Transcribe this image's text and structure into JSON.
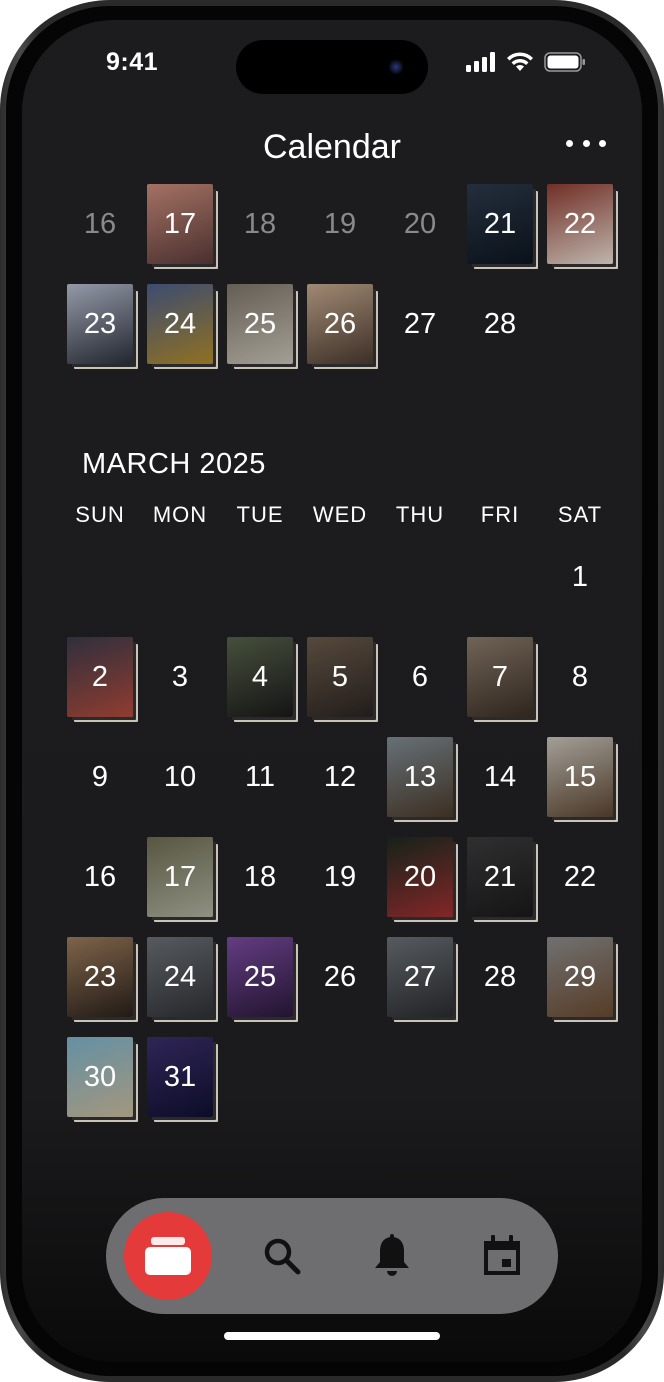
{
  "status_bar": {
    "time": "9:41"
  },
  "header": {
    "title": "Calendar",
    "more_icon": "ellipsis-icon"
  },
  "feb_partial": {
    "rows": [
      [
        {
          "day": "16",
          "dim": true
        },
        {
          "day": "17",
          "dim": true,
          "photo": [
            "#c98b7a",
            "#5a3b3a"
          ]
        },
        {
          "day": "18",
          "dim": true
        },
        {
          "day": "19",
          "dim": true
        },
        {
          "day": "20",
          "dim": true
        },
        {
          "day": "21",
          "dim": true,
          "photo": [
            "#2b3a4a",
            "#0d1520"
          ]
        },
        {
          "day": "22",
          "dim": true,
          "photo": [
            "#8a3a2f",
            "#e8ddd2"
          ]
        }
      ],
      [
        {
          "day": "23",
          "photo": [
            "#b5bccd",
            "#2a2f3a"
          ]
        },
        {
          "day": "24",
          "photo": [
            "#4a5d8a",
            "#b08a2a"
          ]
        },
        {
          "day": "25",
          "photo": [
            "#7b7368",
            "#c8c2b6"
          ]
        },
        {
          "day": "26",
          "photo": [
            "#c4a88d",
            "#4a3a30"
          ]
        },
        {
          "day": "27"
        },
        {
          "day": "28"
        }
      ]
    ]
  },
  "march": {
    "title": "MARCH 2025",
    "weekdays": [
      "SUN",
      "MON",
      "TUE",
      "WED",
      "THU",
      "FRI",
      "SAT"
    ],
    "rows": [
      [
        {},
        {},
        {},
        {},
        {},
        {},
        {
          "day": "1"
        }
      ],
      [
        {
          "day": "2",
          "photo": [
            "#3a3a4a",
            "#b04a3a"
          ]
        },
        {
          "day": "3"
        },
        {
          "day": "4",
          "photo": [
            "#56614a",
            "#1a1a1a"
          ]
        },
        {
          "day": "5",
          "photo": [
            "#6a5a4a",
            "#2a2421"
          ]
        },
        {
          "day": "6"
        },
        {
          "day": "7",
          "photo": [
            "#8a7a6a",
            "#3a2e25"
          ]
        },
        {
          "day": "8"
        }
      ],
      [
        {
          "day": "9"
        },
        {
          "day": "10"
        },
        {
          "day": "11"
        },
        {
          "day": "12"
        },
        {
          "day": "13",
          "photo": [
            "#7d8a92",
            "#4a3a2a"
          ]
        },
        {
          "day": "14"
        },
        {
          "day": "15",
          "photo": [
            "#c7c2b8",
            "#5a4430"
          ]
        }
      ],
      [
        {
          "day": "16"
        },
        {
          "day": "17",
          "photo": [
            "#6a6a50",
            "#b0b0a0"
          ]
        },
        {
          "day": "18"
        },
        {
          "day": "19"
        },
        {
          "day": "20",
          "photo": [
            "#1a2a20",
            "#a03030"
          ]
        },
        {
          "day": "21",
          "photo": [
            "#3a3a3a",
            "#1a1a1a"
          ]
        },
        {
          "day": "22"
        }
      ],
      [
        {
          "day": "23",
          "photo": [
            "#9a7a5a",
            "#2a211b"
          ]
        },
        {
          "day": "24",
          "photo": [
            "#6a6e74",
            "#2f3236"
          ]
        },
        {
          "day": "25",
          "photo": [
            "#7a4aa0",
            "#2a1a3a"
          ]
        },
        {
          "day": "26"
        },
        {
          "day": "27",
          "photo": [
            "#6a6f74",
            "#2a2c30"
          ]
        },
        {
          "day": "28"
        },
        {
          "day": "29",
          "photo": [
            "#8a8a8a",
            "#6a4a30"
          ]
        }
      ],
      [
        {
          "day": "30",
          "photo": [
            "#7ab0c8",
            "#c8b89a"
          ]
        },
        {
          "day": "31",
          "photo": [
            "#3a2e6a",
            "#101030"
          ]
        }
      ]
    ]
  },
  "tabs": [
    {
      "name": "tab-feed",
      "icon": "cards-icon",
      "active": true
    },
    {
      "name": "tab-search",
      "icon": "search-icon"
    },
    {
      "name": "tab-notifications",
      "icon": "bell-icon"
    },
    {
      "name": "tab-calendar",
      "icon": "calendar-icon"
    }
  ],
  "colors": {
    "accent": "#e53a3a",
    "background": "#1c1c1e",
    "tabbar": "#6e6e70"
  }
}
